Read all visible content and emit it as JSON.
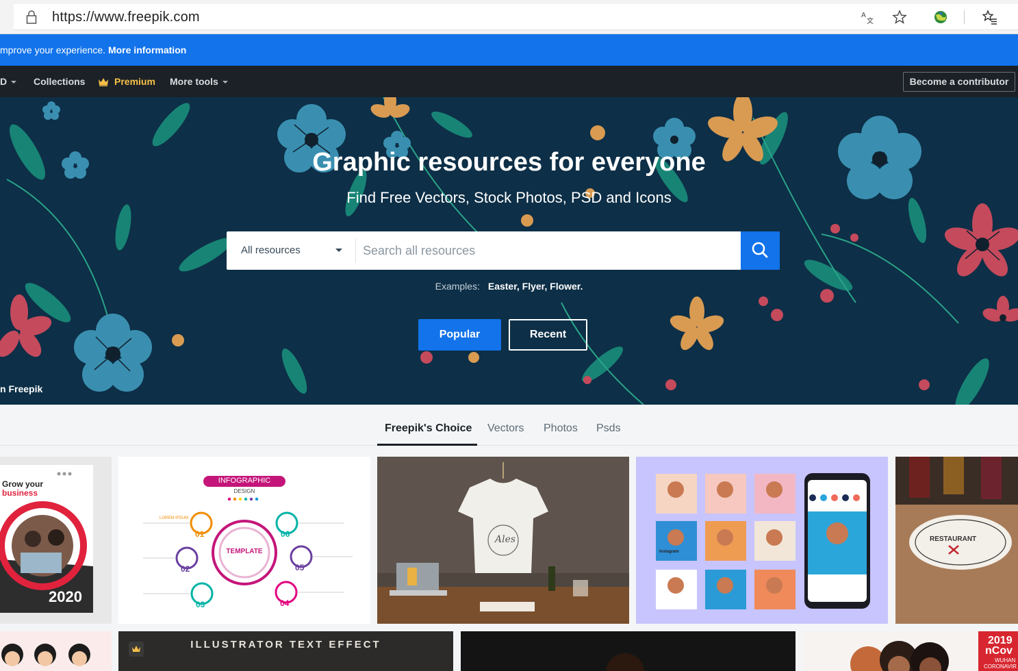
{
  "browser": {
    "url": "https://www.freepik.com",
    "icons": [
      "lock-icon",
      "translate-icon",
      "favorite-star-icon",
      "extension-globe-icon",
      "favorites-list-icon"
    ]
  },
  "cookie_bar": {
    "text": "mprove your experience.",
    "link": "More information"
  },
  "nav": {
    "partial_item": "D",
    "collections": "Collections",
    "premium": "Premium",
    "more_tools": "More tools",
    "become_contributor": "Become a contributor"
  },
  "hero": {
    "title": "Graphic resources for everyone",
    "subtitle": "Find Free Vectors, Stock Photos, PSD and Icons",
    "search": {
      "selected_resource": "All resources",
      "placeholder": "Search all resources"
    },
    "examples": {
      "label": "Examples:",
      "items_text": "Easter, Flyer, Flower."
    },
    "popular_button": "Popular",
    "recent_button": "Recent",
    "credit": "n Freepik"
  },
  "tabs": [
    "Freepik's Choice",
    "Vectors",
    "Photos",
    "Psds"
  ],
  "active_tab": "Freepik's Choice",
  "tiles": {
    "flyer": {
      "headline_1": "Grow your",
      "headline_2": "business",
      "year": "2020"
    },
    "infographic": {
      "badge": "INFOGRAPHIC",
      "design": "DESIGN",
      "center": "TEMPLATE",
      "steps": [
        "01",
        "02",
        "03",
        "04",
        "05",
        "06"
      ],
      "item_label": "LOREM IPSUM"
    },
    "tshirt": {
      "logo": "Ales"
    },
    "instagram": {
      "tag": "Instagram"
    },
    "restaurant": {
      "sign": "RESTAURANT"
    },
    "text_effect": {
      "title": "ILLUSTRATOR TEXT EFFECT"
    },
    "corona": {
      "year": "2019",
      "name": "nCov",
      "sub1": "WUHAN",
      "sub2": "CORONAVIR"
    }
  },
  "colors": {
    "accent": "#1273eb",
    "nav_bg": "#1b2126",
    "hero_bg": "#0d2f47",
    "premium": "#f7c04a"
  }
}
